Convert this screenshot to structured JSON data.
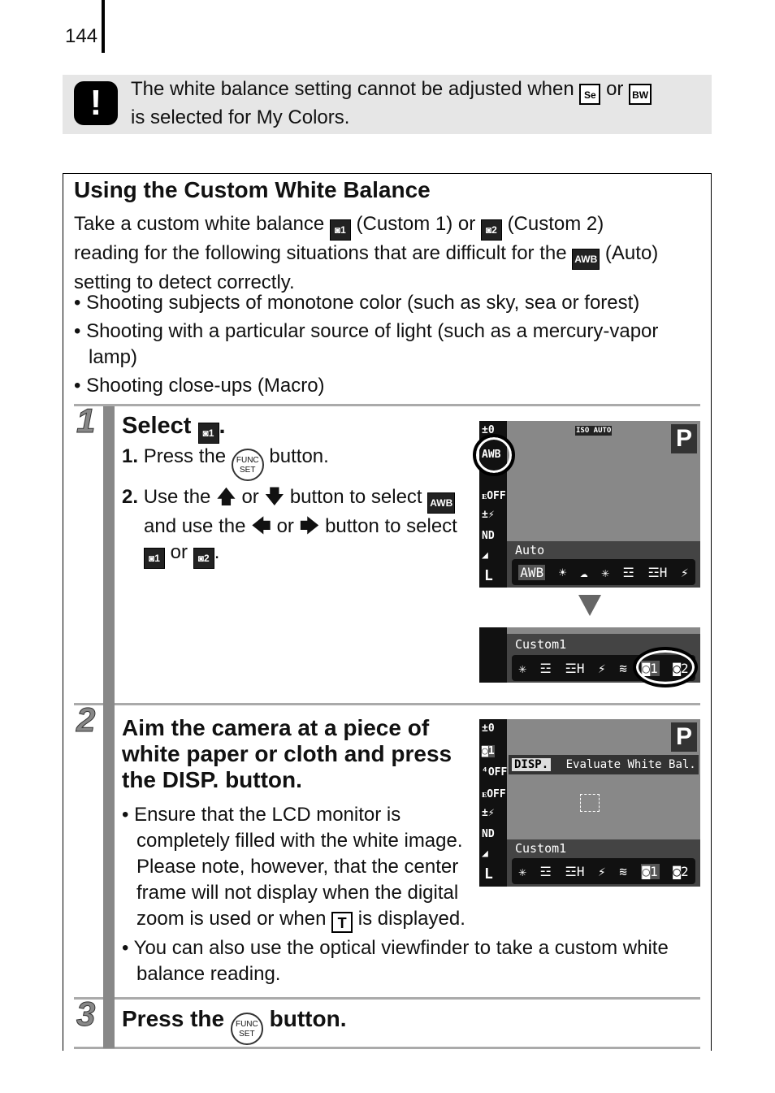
{
  "page_number": "144",
  "caution": {
    "icon": "exclamation-icon",
    "text_1": "The white balance setting cannot be adjusted when",
    "icon_sepia": "Se",
    "or": "or",
    "icon_bw": "BW",
    "text_2": "is selected for My Colors."
  },
  "section": {
    "title": "Using the Custom White Balance",
    "intro_1": "Take a custom white balance",
    "custom1_icon": "◙1",
    "custom1_label": "(Custom 1) or",
    "custom2_icon": "◙2",
    "custom2_label": "(Custom 2)",
    "intro_2": "reading for the following situations that are difficult for the",
    "awb_icon": "AWB",
    "auto_label": "(Auto)",
    "intro_3": "setting to detect correctly.",
    "bullets": [
      "Shooting subjects of monotone color (such as sky, sea or forest)",
      "Shooting with a particular source of light (such as a mercury-vapor lamp)",
      "Shooting close-ups (Macro)"
    ]
  },
  "steps": [
    {
      "number": "1",
      "title": "Select",
      "title_end": ".",
      "sub1_num": "1.",
      "sub1_a": "Press the",
      "func_label": "FUNC SET",
      "sub1_b": "button.",
      "sub2_num": "2.",
      "sub2_a": "Use the",
      "or": "or",
      "sub2_b": "button to select",
      "sub2_c": "and use the",
      "sub2_d": "button to",
      "sub2_e": "select",
      "sub2_f": "."
    },
    {
      "number": "2",
      "title": "Aim the camera at a piece of white paper or cloth and press the DISP. button.",
      "bullets": [
        "Ensure that the LCD monitor is completely filled with the white image. Please note, however, that the center frame will not display when the digital zoom is used or when",
        "You can also use the optical viewfinder to take a custom white balance reading."
      ],
      "t_icon": "T",
      "bullet1_end": "is displayed."
    },
    {
      "number": "3",
      "title_a": "Press the",
      "func_label": "FUNC SET",
      "title_b": "button."
    }
  ],
  "screens": {
    "screen1": {
      "label": "Auto",
      "mode": "P",
      "iso": "ISO AUTO",
      "side": [
        "±0",
        "AWB",
        "⁴OFF",
        "ᴇOFF",
        "±⚡",
        "ND",
        "◢",
        "L"
      ],
      "strip": [
        "AWB",
        "☀",
        "☁",
        "✳",
        "☲",
        "☲H",
        "⚡"
      ]
    },
    "screen2": {
      "label": "Custom1",
      "strip": [
        "✳",
        "☲",
        "☲H",
        "⚡",
        "≋",
        "◙1",
        "◙2"
      ]
    },
    "screen3": {
      "label": "Custom1",
      "mode": "P",
      "disp": "DISP.",
      "message": "Evaluate White Bal.",
      "side": [
        "±0",
        "◙1",
        "⁴OFF",
        "ᴇOFF",
        "±⚡",
        "ND",
        "◢",
        "L"
      ],
      "strip": [
        "✳",
        "☲",
        "☲H",
        "⚡",
        "≋",
        "◙1",
        "◙2"
      ]
    }
  }
}
